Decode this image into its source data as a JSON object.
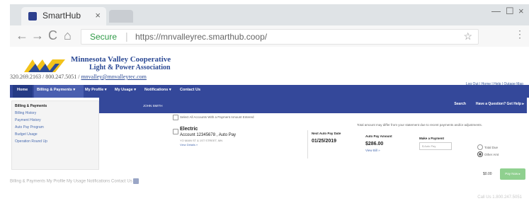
{
  "browser": {
    "tab_title": "SmartHub",
    "tab_close": "×",
    "secure_label": "Secure",
    "separator": "|",
    "url": "https://mnvalleyrec.smarthub.coop/",
    "back": "←",
    "forward": "→",
    "reload": "C",
    "home": "⌂",
    "star": "☆",
    "minimize": "—",
    "maximize": "☐",
    "close": "×",
    "menu": "⋮"
  },
  "header": {
    "org_line1": "Minnesota Valley Cooperative",
    "org_line2": "Light & Power Association",
    "phones": "320.269.2163 / 800.247.5051 / ",
    "email": "mnvalley@mnvalleyrec.com",
    "top_links": "Log Out | Home | Help | Outage Map"
  },
  "nav": {
    "home": "Home",
    "billing": "Billing & Payments ▾",
    "profile": "My Profile ▾",
    "usage": "My Usage ▾",
    "notifications": "Notifications ▾",
    "contact": "Contact Us"
  },
  "subnav": {
    "name": "JOHN SMITH",
    "search": "Search",
    "help": "Have a Question? Get Help ▸"
  },
  "sidebar": {
    "items": [
      {
        "label": "Billing & Payments"
      },
      {
        "label": "Billing History"
      },
      {
        "label": "Payment History"
      },
      {
        "label": "Auto Pay Program"
      },
      {
        "label": "Budget Usage"
      },
      {
        "label": "Operation Round Up"
      }
    ]
  },
  "content": {
    "select_all": "Select All Accounts With a Payment Amount Entered",
    "total_note": "Total amount may differ from your statement due to recent payments and/or adjustments.",
    "service": "Electric",
    "account": "Account 12345678 , Auto Pay",
    "address": "YO MAIN ST & 1ST STREET, MN",
    "view_details": "View Details »",
    "col_autopay_date": "Next Auto Pay Date",
    "autopay_date": "01/25/2019",
    "col_autopay_amount": "Auto Pay Amount",
    "autopay_amount": "$286.00",
    "view_bill": "View Bill »",
    "col_payment": "Make a Payment",
    "payment_placeholder": "$  Auto Pay",
    "total_due": "Total Due",
    "other_amt": "Other Amt",
    "total": "$0.00",
    "pay_now": "Pay Now ▸"
  },
  "footer": {
    "links": "Billing & Payments   My Profile   My Usage   Notifications   Contact Us",
    "phone": "Call Us 1.800.247.5051"
  }
}
